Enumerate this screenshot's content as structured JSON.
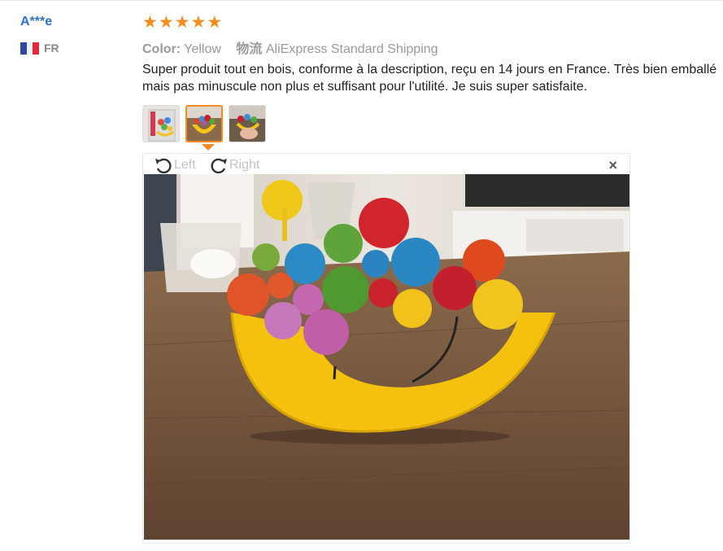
{
  "review": {
    "author": "A***e",
    "country_code": "FR",
    "rating": 5,
    "color_label": "Color:",
    "color_value": "Yellow",
    "shipping_label": "物流",
    "shipping_value": "AliExpress Standard Shipping",
    "text_line1": "Super produit tout en bois, conforme à la description, reçu en 14 jours en France. Très bien emballé",
    "text_line2": "mais pas minuscule non plus et suffisant pour l'utilité. Je suis super satisfaite."
  },
  "viewer": {
    "rotate_left_label": "Left",
    "rotate_right_label": "Right",
    "close_symbol": "×"
  },
  "thumbnails": [
    {
      "name": "package-photo",
      "active": false
    },
    {
      "name": "moon-balance-photo",
      "active": true
    },
    {
      "name": "hand-holding-toy-photo",
      "active": false
    }
  ],
  "colors": {
    "author_link": "#2e6fcb",
    "star": "#f68b1f",
    "active_thumb_border": "#f68b1f"
  }
}
